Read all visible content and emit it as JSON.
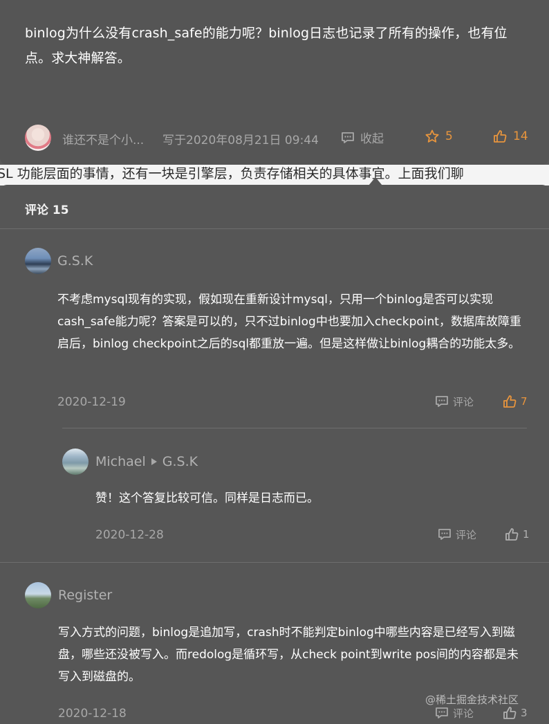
{
  "question": {
    "text": "binlog为什么没有crash_safe的能力呢？binlog日志也记录了所有的操作，也有位点。求大神解答。",
    "author": "谁还不是个小...",
    "date": "写于2020年08月21日 09:44",
    "collapse_label": "收起",
    "star_count": "5",
    "like_count": "14"
  },
  "background_text": "SL 功能层面的事情，还有一块是引擎层，负责存储相关的具体事宜。上面我们聊",
  "comments_header": "评论 15",
  "comments": [
    {
      "author": "G.S.K",
      "text": "不考虑mysql现有的实现，假如现在重新设计mysql，只用一个binlog是否可以实现cash_safe能力呢？答案是可以的，只不过binlog中也要加入checkpoint，数据库故障重启后，binlog checkpoint之后的sql都重放一遍。但是这样做让binlog耦合的功能太多。",
      "date": "2020-12-19",
      "reply_label": "评论",
      "likes": "7"
    },
    {
      "author": "Michael",
      "reply_to": "G.S.K",
      "text": "赞！这个答复比较可信。同样是日志而已。",
      "date": "2020-12-28",
      "reply_label": "评论",
      "likes": "1"
    },
    {
      "author": "Register",
      "text": "写入方式的问题，binlog是追加写，crash时不能判定binlog中哪些内容是已经写入到磁盘，哪些还没被写入。而redolog是循环写，从check point到write pos间的内容都是未写入到磁盘的。",
      "date": "2020-12-18",
      "reply_label": "评论",
      "likes": "3"
    }
  ],
  "watermark": "@稀土掘金技术社区",
  "colors": {
    "accent": "#e8953d",
    "panel": "#565656",
    "muted": "#a8a8a8"
  }
}
